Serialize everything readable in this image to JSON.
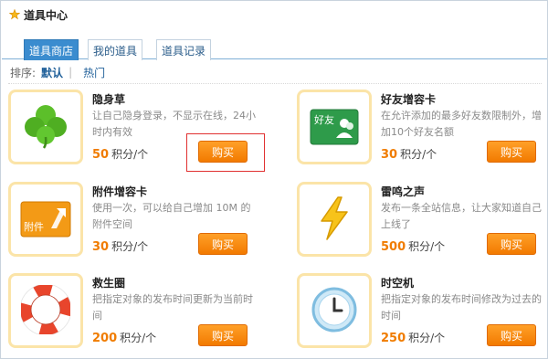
{
  "header": {
    "title": "道具中心"
  },
  "tabs": [
    {
      "label": "道具商店",
      "active": true
    },
    {
      "label": "我的道具",
      "active": false
    },
    {
      "label": "道具记录",
      "active": false
    }
  ],
  "sort": {
    "label": "排序:",
    "options": [
      "默认",
      "热门"
    ],
    "selected": "默认"
  },
  "items": [
    {
      "name": "隐身草",
      "desc": "让自己隐身登录，不显示在线，24小时内有效",
      "price": "50",
      "unit": "积分/个",
      "buy": "购买",
      "icon": "clover-icon"
    },
    {
      "name": "好友增容卡",
      "desc": "在允许添加的最多好友数限制外，增加10个好友名额",
      "price": "30",
      "unit": "积分/个",
      "buy": "购买",
      "icon": "friend-card-icon",
      "icon_text": "好友"
    },
    {
      "name": "附件增容卡",
      "desc": "使用一次，可以给自己增加 10M 的附件空间",
      "price": "30",
      "unit": "积分/个",
      "buy": "购买",
      "icon": "attachment-card-icon",
      "icon_text": "附件"
    },
    {
      "name": "雷鸣之声",
      "desc": "发布一条全站信息，让大家知道自己上线了",
      "price": "500",
      "unit": "积分/个",
      "buy": "购买",
      "icon": "lightning-icon"
    },
    {
      "name": "救生圈",
      "desc": "把指定对象的发布时间更新为当前时间",
      "price": "200",
      "unit": "积分/个",
      "buy": "购买",
      "icon": "lifebuoy-icon"
    },
    {
      "name": "时空机",
      "desc": "把指定对象的发布时间修改为过去的时间",
      "price": "250",
      "unit": "积分/个",
      "buy": "购买",
      "icon": "clock-icon"
    }
  ],
  "colors": {
    "accent": "#3b8ccf",
    "button": "#f27a00",
    "price": "#f07c00",
    "thumb_border": "#fbe4a8",
    "highlight": "#e03030"
  }
}
